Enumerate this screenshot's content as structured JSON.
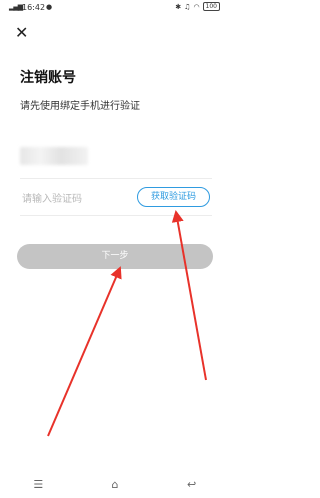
{
  "status_bar": {
    "time": "16:42",
    "signal_icon": "signal-icon",
    "app_icon": "chat-icon",
    "bluetooth_icon": "bluetooth-icon",
    "mute_icon": "bell-off-icon",
    "wifi_icon": "wifi-icon",
    "battery": "100"
  },
  "header": {
    "close_icon": "close-icon"
  },
  "page": {
    "title": "注销账号",
    "subtitle": "请先使用绑定手机进行验证"
  },
  "form": {
    "code_placeholder": "请输入验证码",
    "get_code_label": "获取验证码",
    "next_label": "下一步"
  },
  "nav": {
    "menu_icon": "menu-icon",
    "home_icon": "home-icon",
    "back_icon": "back-icon"
  },
  "colors": {
    "accent": "#2f9be0",
    "button_disabled": "#c4c4c4",
    "annotation": "#e8322a"
  }
}
